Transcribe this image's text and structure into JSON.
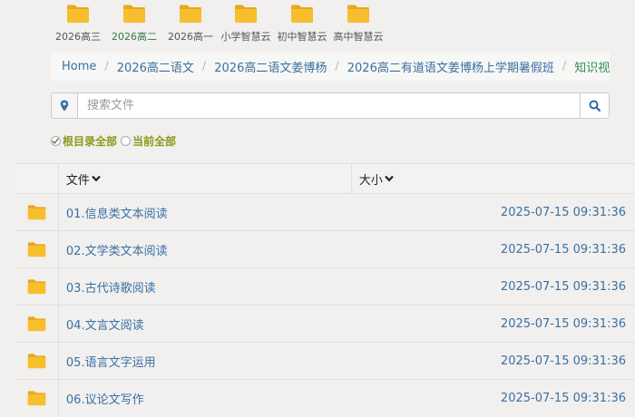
{
  "top_folders": [
    {
      "label": "2026高三",
      "active": false
    },
    {
      "label": "2026高二",
      "active": true
    },
    {
      "label": "2026高一",
      "active": false
    },
    {
      "label": "小学智慧云",
      "active": false
    },
    {
      "label": "初中智慧云",
      "active": false
    },
    {
      "label": "高中智慧云",
      "active": false
    }
  ],
  "breadcrumb": {
    "home": "Home",
    "items": [
      "2026高二语文",
      "2026高二语文姜博杨",
      "2026高二有道语文姜博杨上学期暑假班"
    ],
    "current": "知识视频",
    "separator": "/"
  },
  "search": {
    "placeholder": "搜索文件",
    "value": ""
  },
  "scope": {
    "options": [
      "根目录全部",
      "当前全部"
    ],
    "selected": 0
  },
  "table": {
    "headers": {
      "name": "文件",
      "size": "大小"
    },
    "rows": [
      {
        "name": "01.信息类文本阅读",
        "date": "2025-07-15 09:31:36"
      },
      {
        "name": "02.文学类文本阅读",
        "date": "2025-07-15 09:31:36"
      },
      {
        "name": "03.古代诗歌阅读",
        "date": "2025-07-15 09:31:36"
      },
      {
        "name": "04.文言文阅读",
        "date": "2025-07-15 09:31:36"
      },
      {
        "name": "05.语言文字运用",
        "date": "2025-07-15 09:31:36"
      },
      {
        "name": "06.议论文写作",
        "date": "2025-07-15 09:31:36"
      }
    ]
  },
  "colors": {
    "link": "#3a6fa5",
    "active_green": "#2d8f54",
    "scope_olive": "#8a9a1a",
    "folder_yellow": "#f7bf2e"
  },
  "icons": {
    "folder": "folder-icon",
    "location": "location-pin-icon",
    "search": "search-icon",
    "sort": "chevron-down-icon",
    "check": "check-icon"
  }
}
